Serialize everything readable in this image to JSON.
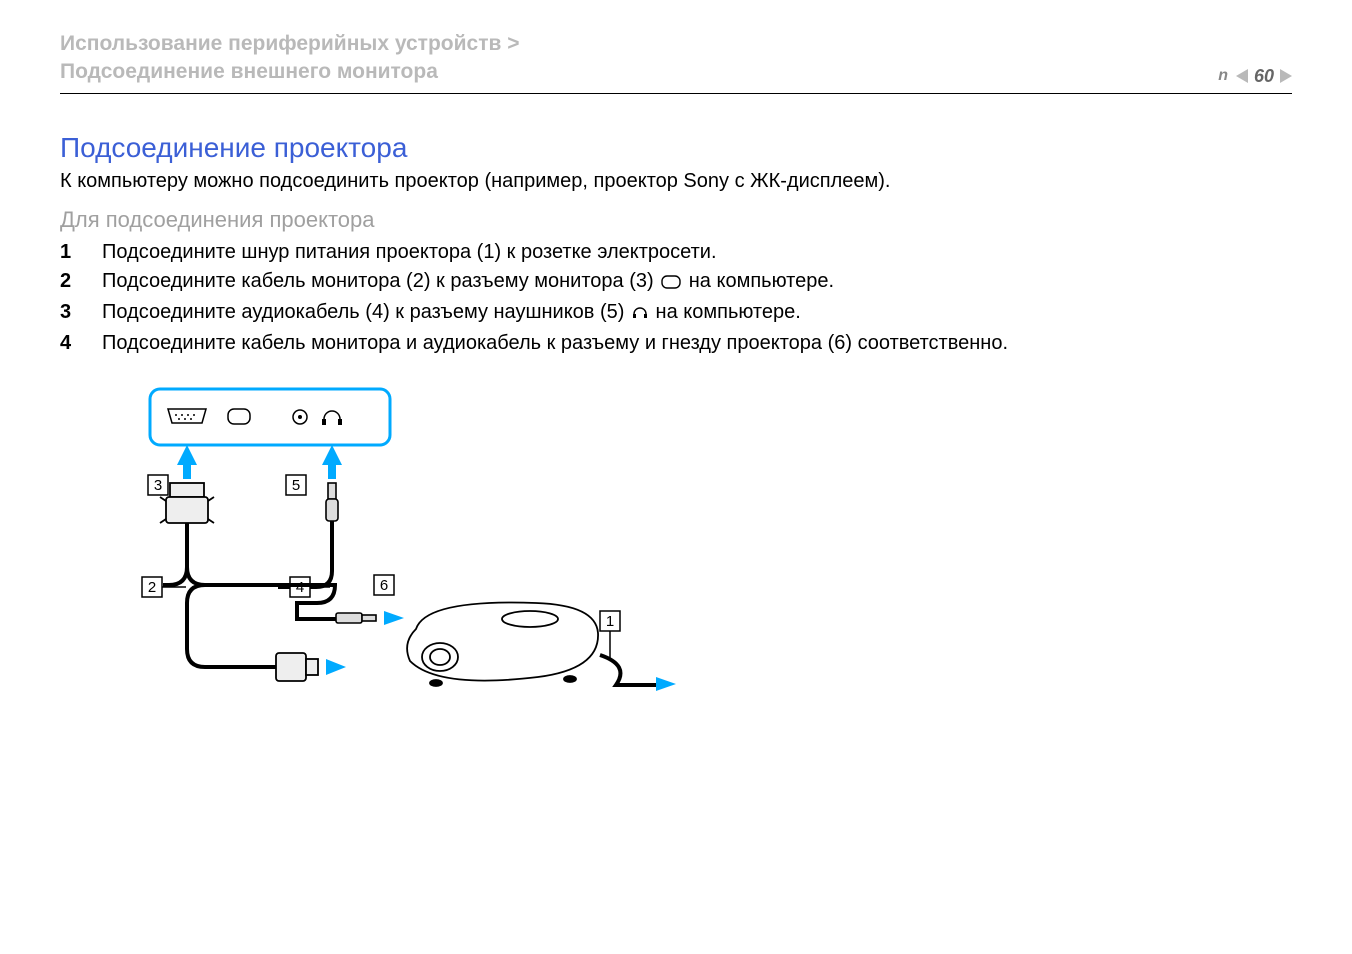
{
  "header": {
    "breadcrumb_line1": "Использование периферийных устройств >",
    "breadcrumb_line2": "Подсоединение внешнего монитора",
    "nav": {
      "n_label": "n",
      "page_number": "60"
    }
  },
  "content": {
    "section_title": "Подсоединение проектора",
    "lead": "К компьютеру можно подсоединить проектор (например, проектор Sony с ЖК-дисплеем).",
    "sub_title": "Для подсоединения проектора",
    "steps": [
      {
        "n": "1",
        "text": "Подсоедините шнур питания проектора (1) к розетке электросети."
      },
      {
        "n": "2",
        "text_a": "Подсоедините кабель монитора (2) к разъему монитора (3) ",
        "icon": "monitor-port-icon",
        "text_b": " на компьютере."
      },
      {
        "n": "3",
        "text_a": "Подсоедините аудиокабель (4) к разъему наушников (5) ",
        "icon": "headphones-icon",
        "text_b": " на компьютере."
      },
      {
        "n": "4",
        "text": "Подсоедините кабель монитора и аудиокабель к разъему и гнезду проектора (6) соответственно."
      }
    ]
  },
  "diagram": {
    "callouts": [
      "1",
      "2",
      "3",
      "4",
      "5",
      "6"
    ]
  }
}
